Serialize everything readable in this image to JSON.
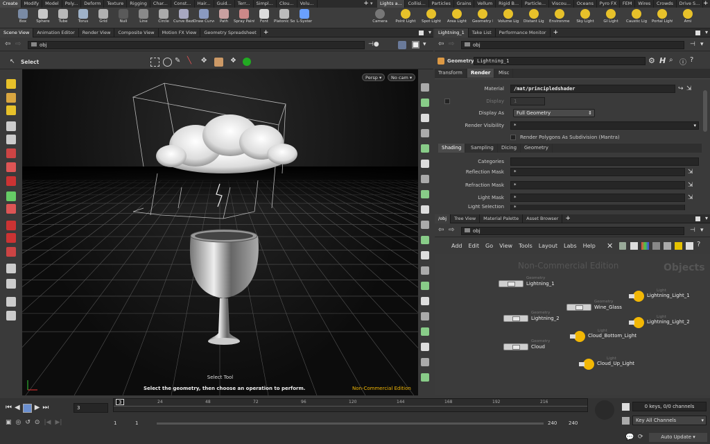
{
  "shelf": {
    "tabs_left": [
      "Create",
      "Modify",
      "Model",
      "Poly...",
      "Deform",
      "Texture",
      "Rigging",
      "Char...",
      "Const...",
      "Hair...",
      "Guid...",
      "Terr...",
      "Simpl...",
      "Clou...",
      "Volu..."
    ],
    "tabs_right": [
      "Lights a...",
      "Collisi...",
      "Particles",
      "Grains",
      "Vellum",
      "Rigid B...",
      "Particle...",
      "Viscou...",
      "Oceans",
      "Pyro FX",
      "FEM",
      "Wires",
      "Crowds",
      "Drive S..."
    ],
    "tools_left": [
      "Box",
      "Sphere",
      "Tube",
      "Torus",
      "Grid",
      "Null",
      "Line",
      "Circle",
      "Curve Bezier",
      "Draw Curve",
      "Path",
      "Spray Paint",
      "Font",
      "Platonic Solids",
      "L-Syster"
    ],
    "tools_right": [
      "Camera",
      "Point Light",
      "Spot Light",
      "Area Light",
      "Geometry Light",
      "Volume Light",
      "Distant Light",
      "Environment Light",
      "Sky Light",
      "GI Light",
      "Caustic Light",
      "Portal Light",
      "Ami"
    ]
  },
  "left_pane": {
    "tabs": [
      "Scene View",
      "Animation Editor",
      "Render View",
      "Composite View",
      "Motion FX View",
      "Geometry Spreadsheet"
    ],
    "path": "obj",
    "select_label": "Select",
    "persp_btn": "Persp",
    "cam_btn": "No cam",
    "select_tool": "Select Tool",
    "hint": "Select the geometry, then choose an operation to perform.",
    "watermark": "Non-Commercial Edition"
  },
  "params_pane": {
    "tabs": [
      "Lightning_1",
      "Take List",
      "Performance Monitor"
    ],
    "path": "obj",
    "node_type": "Geometry",
    "node_name": "Lightning_1",
    "subtabs": [
      "Transform",
      "Render",
      "Misc"
    ],
    "active_subtab": "Render",
    "material_label": "Material",
    "material_value": "/mat/principledshader",
    "display_label": "Display",
    "display_value": "1",
    "display_as_label": "Display As",
    "display_as_value": "Full Geometry",
    "render_vis_label": "Render Visibility",
    "render_vis_value": "*",
    "render_poly_label": "Render Polygons As Subdivision (Mantra)",
    "inner_tabs": [
      "Shading",
      "Sampling",
      "Dicing",
      "Geometry"
    ],
    "categories_label": "Categories",
    "categories_value": "",
    "refl_label": "Reflection Mask",
    "refl_value": "*",
    "refr_label": "Refraction Mask",
    "refr_value": "*",
    "light_mask_label": "Light Mask",
    "light_mask_value": "*",
    "light_sel_label": "Light Selection",
    "light_sel_value": "*"
  },
  "network_pane": {
    "tabs": [
      "/obj",
      "Tree View",
      "Material Palette",
      "Asset Browser"
    ],
    "path": "obj",
    "menu": [
      "Add",
      "Edit",
      "Go",
      "View",
      "Tools",
      "Layout",
      "Labs",
      "Help"
    ],
    "watermark": "Non-Commercial Edition",
    "context_title": "Objects",
    "nodes": [
      {
        "type": "Geometry",
        "name": "Lightning_1"
      },
      {
        "type": "Geometry",
        "name": "Wine_Glass"
      },
      {
        "type": "Geometry",
        "name": "Lightning_2"
      },
      {
        "type": "Geometry",
        "name": "Cloud"
      },
      {
        "type": "Light",
        "name": "Lightning_Light_1"
      },
      {
        "type": "Light",
        "name": "Lightning_Light_2"
      },
      {
        "type": "Light",
        "name": "Cloud_Bottom_Light"
      },
      {
        "type": "Light",
        "name": "Cloud_Up_Light"
      }
    ]
  },
  "timeline": {
    "frame": "3",
    "current_marker": "3",
    "ticks": [
      "24",
      "48",
      "72",
      "96",
      "120",
      "144",
      "168",
      "192",
      "216"
    ],
    "start": "1",
    "start2": "1",
    "end": "240",
    "end2": "240",
    "keys_info": "0 keys, 0/0 channels",
    "key_all": "Key All Channels",
    "auto_update": "Auto Update"
  },
  "colors": {
    "accent": "#f2b705",
    "node_gray": "#cfcfcf",
    "bg": "#3a3a3a"
  }
}
